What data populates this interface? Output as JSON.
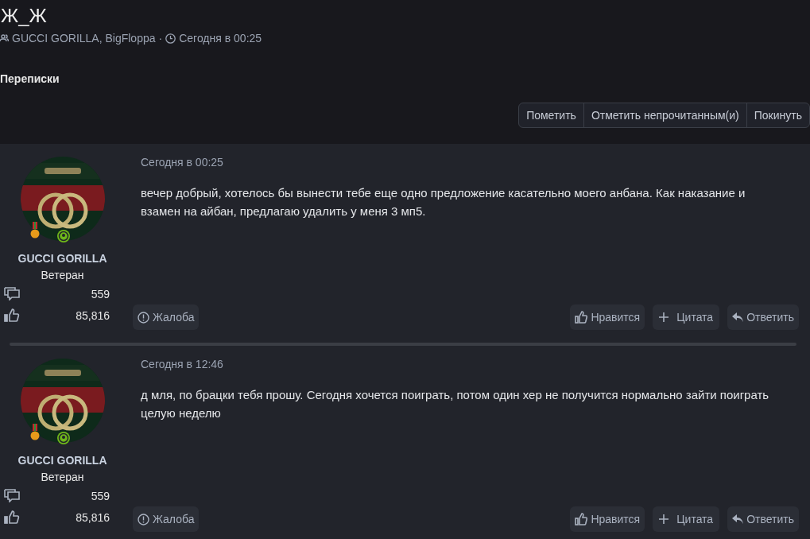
{
  "title": "Ж_Ж",
  "meta": {
    "participants": "GUCCI GORILLA, BigFloppa",
    "separator": "·",
    "time": "Сегодня в 00:25"
  },
  "section_title": "Переписки",
  "actions": [
    "Пометить",
    "Отметить непрочитанным(и)",
    "Покинуть"
  ],
  "posts": [
    {
      "author": "GUCCI GORILLA",
      "rank": "Ветеран",
      "messages_count": "559",
      "reactions_count": "85,816",
      "time": "Сегодня в 00:25",
      "text": "вечер добрый, хотелось бы вынести тебе еще одно предложение касательно моего анбана. Как наказание и взамен на айбан, предлагаю удалить у меня 3 мп5.",
      "report": "Жалоба",
      "buttons": [
        {
          "kind": "like",
          "label": "Нравится"
        },
        {
          "kind": "quote",
          "label": "Цитата"
        },
        {
          "kind": "reply",
          "label": "Ответить"
        }
      ]
    },
    {
      "author": "GUCCI GORILLA",
      "rank": "Ветеран",
      "messages_count": "559",
      "reactions_count": "85,816",
      "time": "Сегодня в 12:46",
      "text": "д мля, по брацки тебя прошу. Сегодня хочется поиграть, потом один хер не получится нормально зайти поиграть целую неделю",
      "report": "Жалоба",
      "buttons": [
        {
          "kind": "like",
          "label": "Нравится"
        },
        {
          "kind": "quote",
          "label": "Цитата"
        },
        {
          "kind": "reply",
          "label": "Ответить"
        }
      ]
    }
  ]
}
